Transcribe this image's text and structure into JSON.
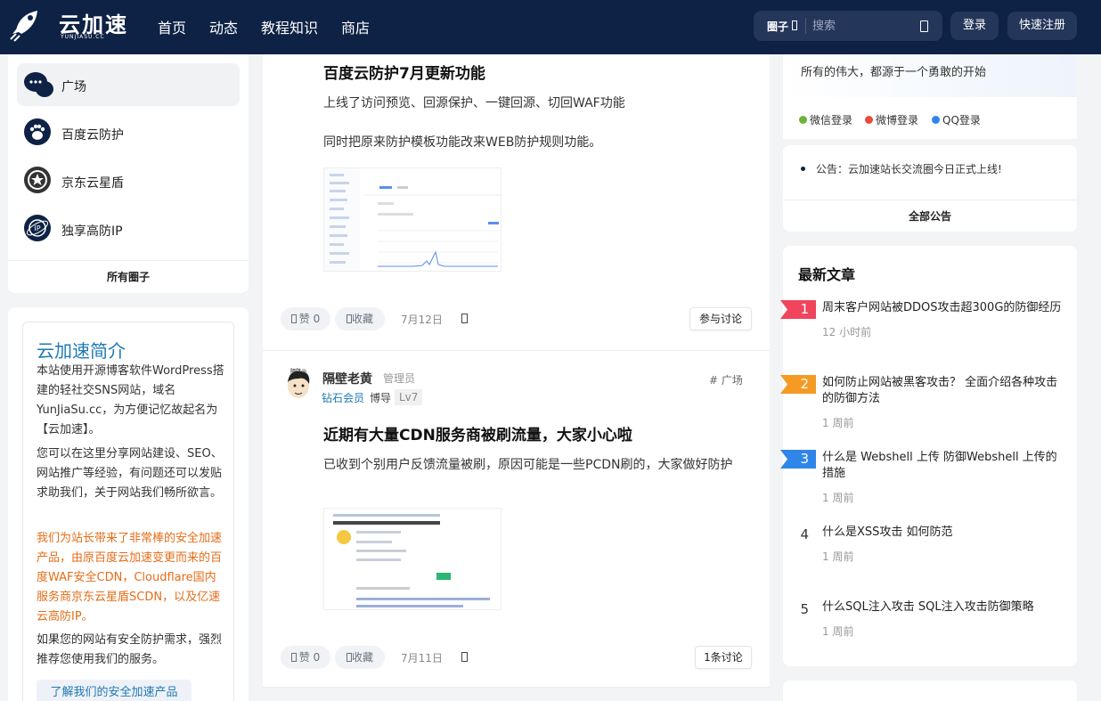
{
  "header": {
    "brand": "云加速",
    "brand_sub": "YUNJIASU.CC",
    "nav": [
      "首页",
      "动态",
      "教程知识",
      "商店"
    ],
    "circle_label": "圈子",
    "search_placeholder": "搜索",
    "login": "登录",
    "register": "快速注册"
  },
  "sidebar": {
    "items": [
      {
        "label": "广场",
        "icon": "chat-bubbles-icon"
      },
      {
        "label": "百度云防护",
        "icon": "baidu-paw-icon"
      },
      {
        "label": "京东云星盾",
        "icon": "star-shield-icon"
      },
      {
        "label": "独享高防IP",
        "icon": "ip-globe-icon"
      }
    ],
    "all_circles": "所有圈子"
  },
  "intro": {
    "title": "云加速简介",
    "p1": "本站使用开源博客软件WordPress搭建的轻社交SNS网站，域名YunJiaSu.cc，为方便记忆故起名为【云加速】。",
    "p2": "您可以在这里分享网站建设、SEO、网站推广等经验，有问题还可以发贴求助我们，关于网站我们畅所欲言。",
    "p3": "我们为站长带来了非常棒的安全加速产品，由原百度云加速变更而来的百度WAF安全CDN，Cloudflare国内服务商京东云星盾SCDN，以及亿速云高防IP。",
    "p4": "如果您的网站有安全防护需求，强烈推荐您使用我们的服务。",
    "cta": "了解我们的安全加速产品"
  },
  "posts": [
    {
      "title": "百度云防护7月更新功能",
      "lines": [
        "上线了访问预览、回源保护、一键回源、切回WAF功能",
        "同时把原来防护模板功能改来WEB防护规则功能。"
      ],
      "like": "赞 0",
      "fav": "收藏",
      "date": "7月12日",
      "discuss": "参与讨论"
    },
    {
      "author": "隔壁老黄",
      "role": "管理员",
      "vip": "钻石会员",
      "title_badge": "博导",
      "level": "Lv7",
      "tag": "# 广场",
      "title": "近期有大量CDN服务商被刷流量，大家小心啦",
      "lines": [
        "已收到个别用户反馈流量被刷，原因可能是一些PCDN刷的，大家做好防护"
      ],
      "like": "赞 0",
      "fav": "收藏",
      "date": "7月11日",
      "discuss": "1条讨论"
    }
  ],
  "right": {
    "motto": "所有的伟大，都源于一个勇敢的开始",
    "social": [
      {
        "label": "微信登录",
        "color": "#6cb33e"
      },
      {
        "label": "微博登录",
        "color": "#e94b3c"
      },
      {
        "label": "QQ登录",
        "color": "#2f86e8"
      }
    ],
    "notice": "公告：云加速站长交流圈今日正式上线!",
    "all_notices": "全部公告",
    "latest_title": "最新文章",
    "articles": [
      {
        "rank": "1",
        "title": "周末客户网站被DDOS攻击超300G的防御经历",
        "time": "12 小时前",
        "color": "#f0455d"
      },
      {
        "rank": "2",
        "title": "如何防止网站被黑客攻击？ 全面介绍各种攻击的防御方法",
        "time": "1 周前",
        "color": "#f59a23"
      },
      {
        "rank": "3",
        "title": "什么是 Webshell 上传 防御Webshell 上传的措施",
        "time": "1 周前",
        "color": "#2f86e8"
      },
      {
        "rank": "4",
        "title": "什么是XSS攻击 如何防范",
        "time": "1 周前",
        "color": ""
      },
      {
        "rank": "5",
        "title": "什么SQL注入攻击 SQL注入攻击防御策略",
        "time": "1 周前",
        "color": ""
      }
    ]
  }
}
